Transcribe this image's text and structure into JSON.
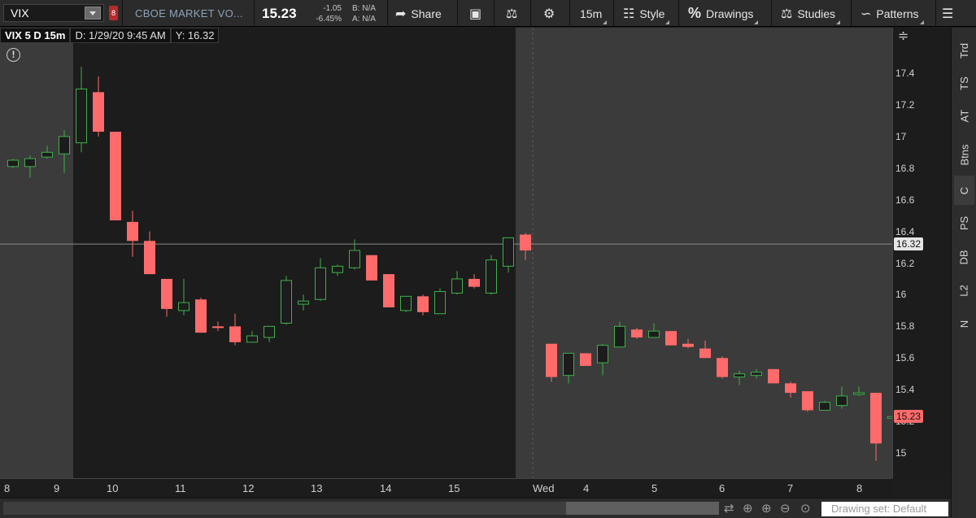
{
  "toolbar": {
    "symbol": "VIX",
    "link_chip": "8",
    "description": "CBOE MARKET VO...",
    "last_price": "15.23",
    "net_change": "-1.05",
    "net_change_pct": "-6.45%",
    "bid": "B: N/A",
    "ask": "A: N/A",
    "share_label": "Share",
    "timeframe_label": "15m",
    "style_label": "Style",
    "drawings_label": "Drawings",
    "studies_label": "Studies",
    "patterns_label": "Patterns"
  },
  "chart_header": {
    "title": "VIX 5 D 15m",
    "date": "D: 1/29/20 9:45 AM",
    "yvalue": "Y: 16.32"
  },
  "side_tabs": [
    {
      "label": "Trd"
    },
    {
      "label": "TS"
    },
    {
      "label": "AT"
    },
    {
      "label": "Btns"
    },
    {
      "label": "C"
    },
    {
      "label": "PS"
    },
    {
      "label": "DB"
    },
    {
      "label": "L2"
    },
    {
      "label": "N"
    }
  ],
  "bottom_bar": {
    "drawing_set": "Drawing set: Default"
  },
  "colors": {
    "up": "#3fb04a",
    "down": "#ff6b6b",
    "extended_hours_bg": "#3b3b3b",
    "regular_hours_bg": "#1c1c1c"
  },
  "chart_data": {
    "type": "candlestick",
    "ylim": [
      14.85,
      17.6
    ],
    "y_ticks": [
      "17.4",
      "17.2",
      "17",
      "16.8",
      "16.6",
      "16.4",
      "16.2",
      "16",
      "15.8",
      "15.6",
      "15.4",
      "15.2",
      "15"
    ],
    "x_ticks": [
      "8",
      "9",
      "10",
      "11",
      "12",
      "13",
      "14",
      "15",
      "Wed",
      "4",
      "5",
      "6",
      "7",
      "8"
    ],
    "crosshair_price": "16.32",
    "last_price_tag": "15.23",
    "candles": [
      {
        "o": 16.81,
        "h": 16.86,
        "l": 16.8,
        "c": 16.85
      },
      {
        "o": 16.81,
        "h": 16.88,
        "l": 16.74,
        "c": 16.86
      },
      {
        "o": 16.87,
        "h": 16.94,
        "l": 16.86,
        "c": 16.9
      },
      {
        "o": 16.89,
        "h": 17.04,
        "l": 16.77,
        "c": 17.0
      },
      {
        "o": 16.96,
        "h": 17.44,
        "l": 16.9,
        "c": 17.3
      },
      {
        "o": 17.28,
        "h": 17.38,
        "l": 17.0,
        "c": 17.03
      },
      {
        "o": 17.03,
        "h": 17.03,
        "l": 16.47,
        "c": 16.47
      },
      {
        "o": 16.46,
        "h": 16.53,
        "l": 16.24,
        "c": 16.34
      },
      {
        "o": 16.34,
        "h": 16.4,
        "l": 16.13,
        "c": 16.13
      },
      {
        "o": 16.1,
        "h": 16.1,
        "l": 15.86,
        "c": 15.91
      },
      {
        "o": 15.9,
        "h": 16.1,
        "l": 15.87,
        "c": 15.95
      },
      {
        "o": 15.97,
        "h": 15.98,
        "l": 15.76,
        "c": 15.76
      },
      {
        "o": 15.8,
        "h": 15.83,
        "l": 15.77,
        "c": 15.79
      },
      {
        "o": 15.8,
        "h": 15.88,
        "l": 15.68,
        "c": 15.7
      },
      {
        "o": 15.7,
        "h": 15.77,
        "l": 15.7,
        "c": 15.74
      },
      {
        "o": 15.73,
        "h": 15.8,
        "l": 15.7,
        "c": 15.8
      },
      {
        "o": 15.82,
        "h": 16.12,
        "l": 15.81,
        "c": 16.09
      },
      {
        "o": 15.94,
        "h": 16.0,
        "l": 15.9,
        "c": 15.96
      },
      {
        "o": 15.97,
        "h": 16.23,
        "l": 15.96,
        "c": 16.17
      },
      {
        "o": 16.14,
        "h": 16.19,
        "l": 16.12,
        "c": 16.18
      },
      {
        "o": 16.17,
        "h": 16.35,
        "l": 16.16,
        "c": 16.28
      },
      {
        "o": 16.25,
        "h": 16.25,
        "l": 16.09,
        "c": 16.09
      },
      {
        "o": 16.13,
        "h": 16.13,
        "l": 15.92,
        "c": 15.92
      },
      {
        "o": 15.9,
        "h": 15.99,
        "l": 15.89,
        "c": 15.99
      },
      {
        "o": 15.99,
        "h": 16.0,
        "l": 15.87,
        "c": 15.89
      },
      {
        "o": 15.88,
        "h": 16.04,
        "l": 15.88,
        "c": 16.02
      },
      {
        "o": 16.01,
        "h": 16.15,
        "l": 16.0,
        "c": 16.1
      },
      {
        "o": 16.1,
        "h": 16.13,
        "l": 16.04,
        "c": 16.05
      },
      {
        "o": 16.01,
        "h": 16.25,
        "l": 16.0,
        "c": 16.22
      },
      {
        "o": 16.18,
        "h": 16.36,
        "l": 16.14,
        "c": 16.36
      },
      {
        "o": 16.38,
        "h": 16.39,
        "l": 16.22,
        "c": 16.28
      },
      {
        "o": 15.69,
        "h": 15.69,
        "l": 15.45,
        "c": 15.48
      },
      {
        "o": 15.49,
        "h": 15.62,
        "l": 15.44,
        "c": 15.63
      },
      {
        "o": 15.63,
        "h": 15.63,
        "l": 15.55,
        "c": 15.55
      },
      {
        "o": 15.57,
        "h": 15.69,
        "l": 15.49,
        "c": 15.68
      },
      {
        "o": 15.67,
        "h": 15.83,
        "l": 15.67,
        "c": 15.8
      },
      {
        "o": 15.78,
        "h": 15.79,
        "l": 15.72,
        "c": 15.73
      },
      {
        "o": 15.73,
        "h": 15.82,
        "l": 15.73,
        "c": 15.77
      },
      {
        "o": 15.77,
        "h": 15.77,
        "l": 15.68,
        "c": 15.68
      },
      {
        "o": 15.69,
        "h": 15.72,
        "l": 15.66,
        "c": 15.67
      },
      {
        "o": 15.66,
        "h": 15.71,
        "l": 15.6,
        "c": 15.6
      },
      {
        "o": 15.6,
        "h": 15.61,
        "l": 15.47,
        "c": 15.48
      },
      {
        "o": 15.48,
        "h": 15.52,
        "l": 15.43,
        "c": 15.5
      },
      {
        "o": 15.49,
        "h": 15.53,
        "l": 15.47,
        "c": 15.51
      },
      {
        "o": 15.53,
        "h": 15.53,
        "l": 15.44,
        "c": 15.44
      },
      {
        "o": 15.44,
        "h": 15.45,
        "l": 15.35,
        "c": 15.38
      },
      {
        "o": 15.39,
        "h": 15.39,
        "l": 15.26,
        "c": 15.27
      },
      {
        "o": 15.27,
        "h": 15.33,
        "l": 15.27,
        "c": 15.32
      },
      {
        "o": 15.3,
        "h": 15.42,
        "l": 15.28,
        "c": 15.36
      },
      {
        "o": 15.37,
        "h": 15.42,
        "l": 15.36,
        "c": 15.38
      },
      {
        "o": 15.38,
        "h": 15.38,
        "l": 14.95,
        "c": 15.06
      },
      {
        "o": 15.23,
        "h": 15.23,
        "l": 15.23,
        "c": 15.23
      }
    ]
  }
}
